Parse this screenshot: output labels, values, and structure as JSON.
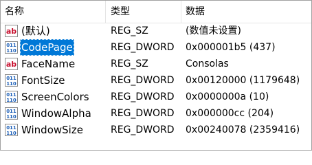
{
  "columns": {
    "name": "名称",
    "type": "类型",
    "data": "数据"
  },
  "rows": [
    {
      "name": "(默认)",
      "type": "REG_SZ",
      "data": "(数值未设置)",
      "icon": "string-value-icon",
      "selected": false
    },
    {
      "name": "CodePage",
      "type": "REG_DWORD",
      "data": "0x000001b5 (437)",
      "icon": "binary-value-icon",
      "selected": true
    },
    {
      "name": "FaceName",
      "type": "REG_SZ",
      "data": "Consolas",
      "icon": "string-value-icon",
      "selected": false
    },
    {
      "name": "FontSize",
      "type": "REG_DWORD",
      "data": "0x00120000 (1179648)",
      "icon": "binary-value-icon",
      "selected": false
    },
    {
      "name": "ScreenColors",
      "type": "REG_DWORD",
      "data": "0x0000000a (10)",
      "icon": "binary-value-icon",
      "selected": false
    },
    {
      "name": "WindowAlpha",
      "type": "REG_DWORD",
      "data": "0x000000cc (204)",
      "icon": "binary-value-icon",
      "selected": false
    },
    {
      "name": "WindowSize",
      "type": "REG_DWORD",
      "data": "0x00240078 (2359416)",
      "icon": "binary-value-icon",
      "selected": false
    }
  ],
  "colors": {
    "selection": "#0078d7",
    "string_icon_red": "#c8102e",
    "binary_icon_blue": "#1c5fb8",
    "header_divider": "#e5e5e5"
  }
}
